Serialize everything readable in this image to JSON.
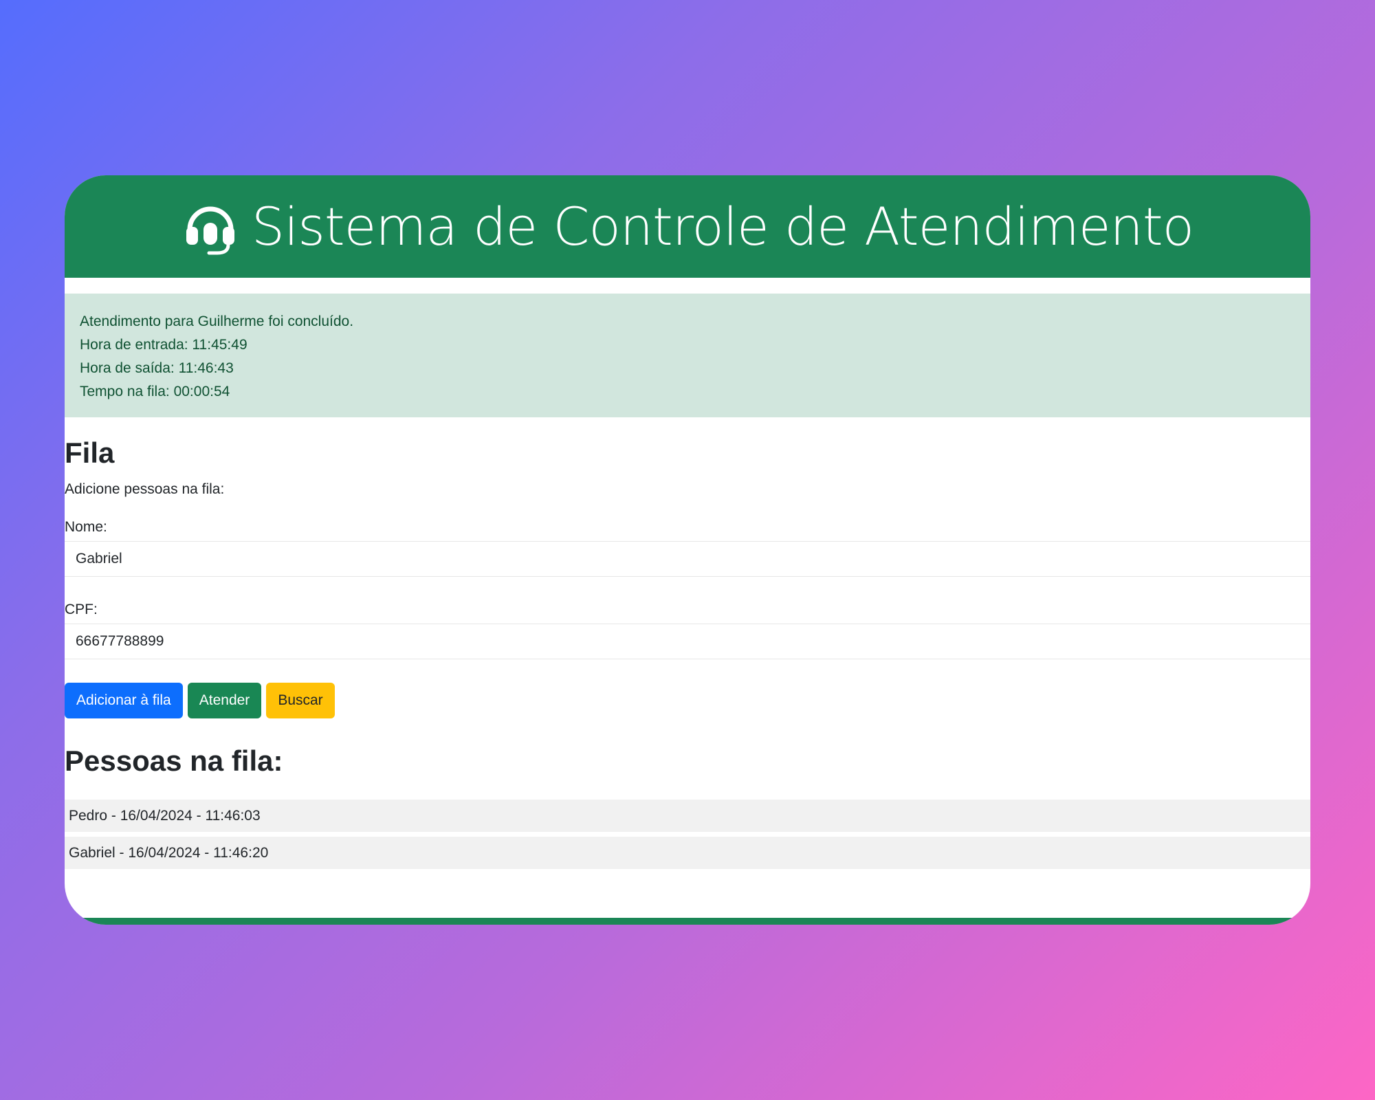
{
  "header": {
    "title": "Sistema de Controle de Atendimento",
    "icon": "headset-icon"
  },
  "alert": {
    "lines": [
      "Atendimento para Guilherme foi concluído.",
      "Hora de entrada: 11:45:49",
      "Hora de saída: 11:46:43",
      "Tempo na fila: 00:00:54"
    ]
  },
  "form": {
    "title": "Fila",
    "help": "Adicione pessoas na fila:",
    "name_label": "Nome:",
    "name_value": "Gabriel",
    "cpf_label": "CPF:",
    "cpf_value": "66677788899",
    "buttons": {
      "add": "Adicionar à fila",
      "serve": "Atender",
      "search": "Buscar"
    }
  },
  "queue": {
    "title": "Pessoas na fila:",
    "items": [
      "Pedro - 16/04/2024 - 11:46:03",
      "Gabriel - 16/04/2024 - 11:46:20"
    ]
  },
  "colors": {
    "header_green": "#1b8656",
    "alert_bg": "#d1e6dd",
    "alert_text": "#0f5132",
    "primary": "#0d6efd",
    "success": "#198754",
    "warning": "#ffc107"
  }
}
